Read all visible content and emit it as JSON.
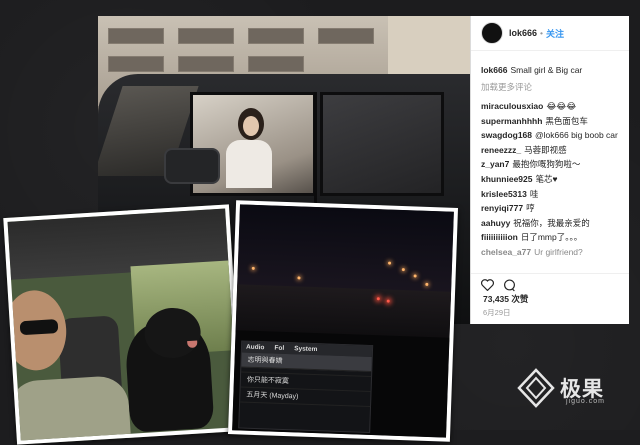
{
  "instagram": {
    "username": "lok666",
    "follow_label": "关注",
    "caption_user": "lok666",
    "caption_text": "Small girl & Big car",
    "load_more": "加载更多评论",
    "comments": [
      {
        "user": "miraculousxiao",
        "text": "😂😂😂"
      },
      {
        "user": "supermanhhhh",
        "text": "黑色面包车"
      },
      {
        "user": "swagdog168",
        "text": "@lok666 big boob car"
      },
      {
        "user": "reneezzz_",
        "text": "马蓉即视感"
      },
      {
        "user": "z_yan7",
        "text": "最抱你嘅狗狗啦～"
      },
      {
        "user": "khunniee925",
        "text": "笔芯♥"
      },
      {
        "user": "krislee5313",
        "text": "哇"
      },
      {
        "user": "renyiqi777",
        "text": "哼"
      },
      {
        "user": "aahuyy",
        "text": "祝福你，我最亲爱的"
      },
      {
        "user": "fiiiiiiiiiion",
        "text": "日了mmp了。。。"
      },
      {
        "user": "chelsea_a77",
        "text": "Ur girlfriend?"
      }
    ],
    "likes": "73,435 次赞",
    "date": "6月29日"
  },
  "night_screen": {
    "tabs": [
      "Audio",
      "Fol",
      "System"
    ],
    "tracks": [
      "志明與春嬌",
      "",
      "你只能不寂寞",
      "五月天 (Mayday)"
    ]
  },
  "watermark": {
    "brand": "极果",
    "url": "jiguo.com"
  },
  "colors": {
    "link_blue": "#3897f0",
    "background": "#1c1c1e"
  }
}
